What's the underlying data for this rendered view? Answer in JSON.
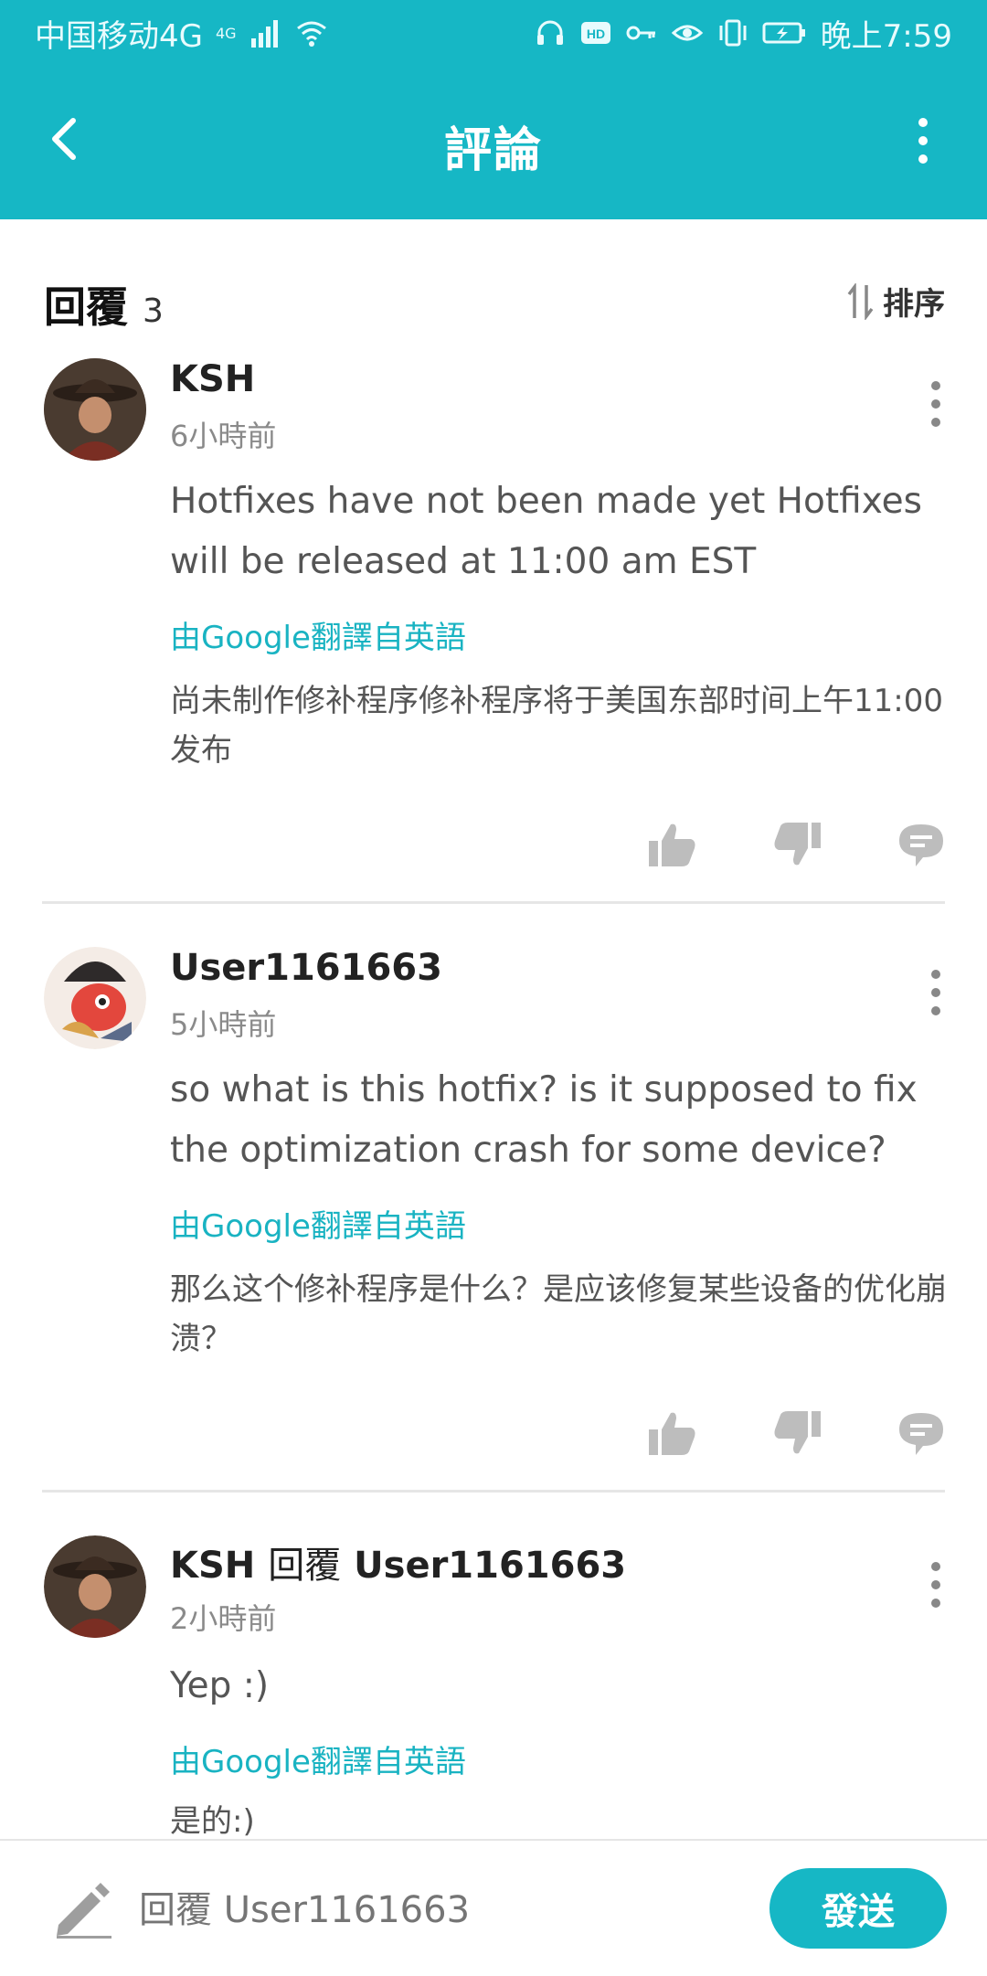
{
  "status_bar": {
    "carrier": "中国移动4G",
    "network_badge": "4G",
    "time": "晚上7:59",
    "icons": [
      "signal-icon",
      "wifi-icon",
      "headphones-icon",
      "hd-icon",
      "key-icon",
      "eye-icon",
      "vibrate-icon",
      "battery-icon"
    ]
  },
  "app_bar": {
    "title": "評論",
    "back_icon": "chevron-left-icon",
    "more_icon": "more-vert-icon"
  },
  "replies_header": {
    "label": "回覆",
    "count": "3",
    "sort_label": "排序",
    "sort_icon": "sort-icon"
  },
  "comments": [
    {
      "author": "KSH",
      "reply_to": "",
      "time": "6小時前",
      "text": "Hotfixes have not been made yet Hotfixes will be released at 11:00 am EST",
      "translation_label": "由Google翻譯自英語",
      "translation": "尚未制作修补程序修补程序将于美国东部时间上午11:00发布"
    },
    {
      "author": "User1161663",
      "reply_to": "",
      "time": "5小時前",
      "text": "so what is this hotfix? is it supposed to fix the optimization crash for some device?",
      "translation_label": "由Google翻譯自英語",
      "translation": "那么这个修补程序是什么？是应该修复某些设备的优化崩溃？"
    },
    {
      "author": "KSH",
      "reply_word": "回覆",
      "reply_to": "User1161663",
      "time": "2小時前",
      "text": "Yep :)",
      "translation_label": "由Google翻譯自英語",
      "translation": "是的:)"
    }
  ],
  "bottom_bar": {
    "placeholder": "回覆 User1161663",
    "send_label": "發送",
    "pencil_icon": "pencil-icon"
  },
  "colors": {
    "accent": "#16b7c5",
    "translate_link": "#19b3c2"
  }
}
